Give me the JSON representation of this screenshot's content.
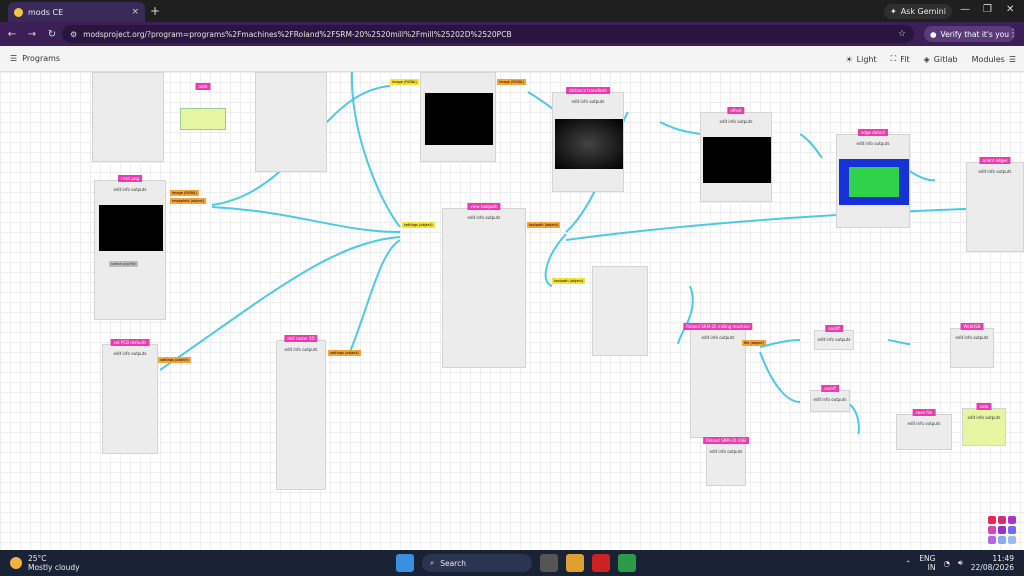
{
  "browser": {
    "tab_title": "mods CE",
    "tab_close": "×",
    "new_tab": "+",
    "gemini_label": "Ask Gemini",
    "url": "modsproject.org/?program=programs%2Fmachines%2FRoland%2FSRM-20%2520mill%2Fmill%25202D%2520PCB",
    "verify_label": "Verify that it's you",
    "min": "—",
    "max": "❐",
    "close": "✕",
    "back": "←",
    "forward": "→",
    "reload": "↻"
  },
  "toolbar": {
    "programs_label": "Programs",
    "light_label": "Light",
    "fit_label": "Fit",
    "gitlab_label": "Gitlab",
    "modules_label": "Modules"
  },
  "modules": [
    {
      "title": "read png",
      "sub": "edit info outputs"
    },
    {
      "title": "note",
      "sub": "edit info outputs"
    },
    {
      "title": "set PCB defaults",
      "sub": "edit info outputs"
    },
    {
      "title": "mill raster 2D",
      "sub": "edit info outputs"
    },
    {
      "title": "distance transform",
      "sub": "edit info outputs"
    },
    {
      "title": "offset",
      "sub": "edit info outputs"
    },
    {
      "title": "edge detect",
      "sub": "edit info outputs"
    },
    {
      "title": "orient edges",
      "sub": "edit info outputs"
    },
    {
      "title": "view toolpath",
      "sub": "edit info outputs"
    },
    {
      "title": "Roland SRM-20 milling machine",
      "sub": "edit info outputs"
    },
    {
      "title": "Roland SRM-20 USB",
      "sub": "edit info outputs"
    },
    {
      "title": "on/off",
      "sub": "edit info outputs"
    },
    {
      "title": "on/off",
      "sub": "edit info outputs"
    },
    {
      "title": "WebUSB",
      "sub": "edit info outputs"
    },
    {
      "title": "save file",
      "sub": "edit info outputs"
    },
    {
      "title": "note",
      "sub": "edit info outputs"
    }
  ],
  "ports": {
    "image_rgba": "image (RGBA)",
    "imageinfo": "imageInfo (object)",
    "settings": "settings (object)",
    "toolpath": "toolpath (object)",
    "file": "file (object)"
  },
  "taskbar": {
    "temp": "25°C",
    "weather": "Mostly cloudy",
    "search": "Search",
    "lang1": "ENG",
    "lang2": "IN",
    "time": "11:49",
    "date": "22/08/2026"
  },
  "colors": {
    "wire": "#4cc9e8",
    "title_magenta": "#ee3ab0",
    "port_in": "#f5e23a",
    "port_out": "#f5a43a",
    "browser_purple": "#3b1f57"
  },
  "icons": [
    "programs-menu-icon",
    "light-icon",
    "fit-icon",
    "gitlab-icon",
    "modules-menu-icon"
  ]
}
